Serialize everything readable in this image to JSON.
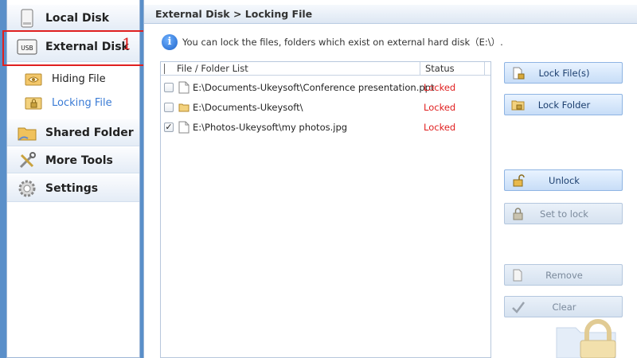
{
  "sidebar": {
    "local_disk": "Local Disk",
    "external_disk": "External Disk",
    "external_disk_usb_label": "USB",
    "annotation_number": "1",
    "sub_items": [
      {
        "label": "Hiding File"
      },
      {
        "label": "Locking File"
      }
    ],
    "shared_folder": "Shared Folder",
    "more_tools": "More Tools",
    "settings": "Settings"
  },
  "header": {
    "breadcrumb": "External Disk > Locking File"
  },
  "info": {
    "text": "You can lock the files, folders which exist on external hard disk（E:\\）."
  },
  "file_list": {
    "columns": [
      "File / Folder List",
      "Status"
    ],
    "rows": [
      {
        "path": "E:\\Documents-Ukeysoft\\Conference presentation.ppt",
        "status": "Locked",
        "checked": false,
        "type": "file"
      },
      {
        "path": "E:\\Documents-Ukeysoft\\",
        "status": "Locked",
        "checked": false,
        "type": "folder"
      },
      {
        "path": "E:\\Photos-Ukeysoft\\my photos.jpg",
        "status": "Locked",
        "checked": true,
        "type": "file"
      }
    ]
  },
  "buttons": {
    "lock_files": "Lock File(s)",
    "lock_folder": "Lock Folder",
    "unlock": "Unlock",
    "set_to_lock": "Set to lock",
    "remove": "Remove",
    "clear": "Clear"
  },
  "colors": {
    "status_locked": "#e02020",
    "accent": "#3a7bd5",
    "highlight_box": "#e02020"
  }
}
